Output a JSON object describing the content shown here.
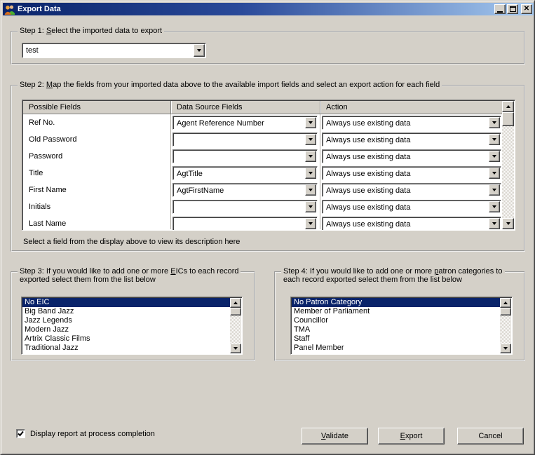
{
  "window": {
    "title": "Export Data"
  },
  "titlebar_buttons": {
    "minimize": "minimize",
    "maximize": "maximize",
    "close": "close"
  },
  "step1": {
    "legend": {
      "pre": "Step 1: ",
      "key": "S",
      "post": "elect the imported data to export"
    },
    "combo_value": "test"
  },
  "step2": {
    "legend": {
      "pre": "Step 2: ",
      "key": "M",
      "post": "ap the fields from your imported data above to the available import fields and select an export action for each field"
    },
    "headers": [
      "Possible Fields",
      "Data Source Fields",
      "Action"
    ],
    "rows": [
      {
        "field": "Ref No.",
        "source": "Agent Reference Number",
        "action": "Always use existing data"
      },
      {
        "field": "Old Password",
        "source": "",
        "action": "Always use existing data"
      },
      {
        "field": "Password",
        "source": "",
        "action": "Always use existing data"
      },
      {
        "field": "Title",
        "source": "AgtTitle",
        "action": "Always use existing data"
      },
      {
        "field": "First Name",
        "source": "AgtFirstName",
        "action": "Always use existing data"
      },
      {
        "field": "Initials",
        "source": "",
        "action": "Always use existing data"
      },
      {
        "field": "Last Name",
        "source": "",
        "action": "Always use existing data"
      }
    ],
    "hint": "Select a field from the display above to view its description here"
  },
  "step3": {
    "legend_line1": {
      "pre": "Step 3: If you would like to add one or more ",
      "key": "E",
      "post": "ICs to each record"
    },
    "legend_line2": "exported select them from the list below",
    "items": [
      "No EIC",
      "Big Band Jazz",
      "Jazz Legends",
      "Modern Jazz",
      "Artrix Classic Films",
      "Traditional Jazz"
    ],
    "selected": "No EIC"
  },
  "step4": {
    "legend_line1": {
      "pre": "Step 4: If you would like to add one or more ",
      "key": "p",
      "post": "atron categories to"
    },
    "legend_line2": "each record exported select them from the list below",
    "items": [
      "No Patron Category",
      "Member of Parliament",
      "Councillor",
      "TMA",
      "Staff",
      "Panel Member"
    ],
    "selected": "No Patron Category"
  },
  "footer": {
    "checkbox_label": "Display report at process completion",
    "checkbox_checked": true,
    "validate": {
      "key": "V",
      "post": "alidate"
    },
    "export": {
      "key": "E",
      "post": "xport"
    },
    "cancel": "Cancel"
  },
  "colors": {
    "dialog_bg": "#d4d0c8",
    "titlebar_left": "#0a246a",
    "titlebar_right": "#a6caf0",
    "selection": "#0a246a",
    "selection_text": "#ffffff"
  }
}
